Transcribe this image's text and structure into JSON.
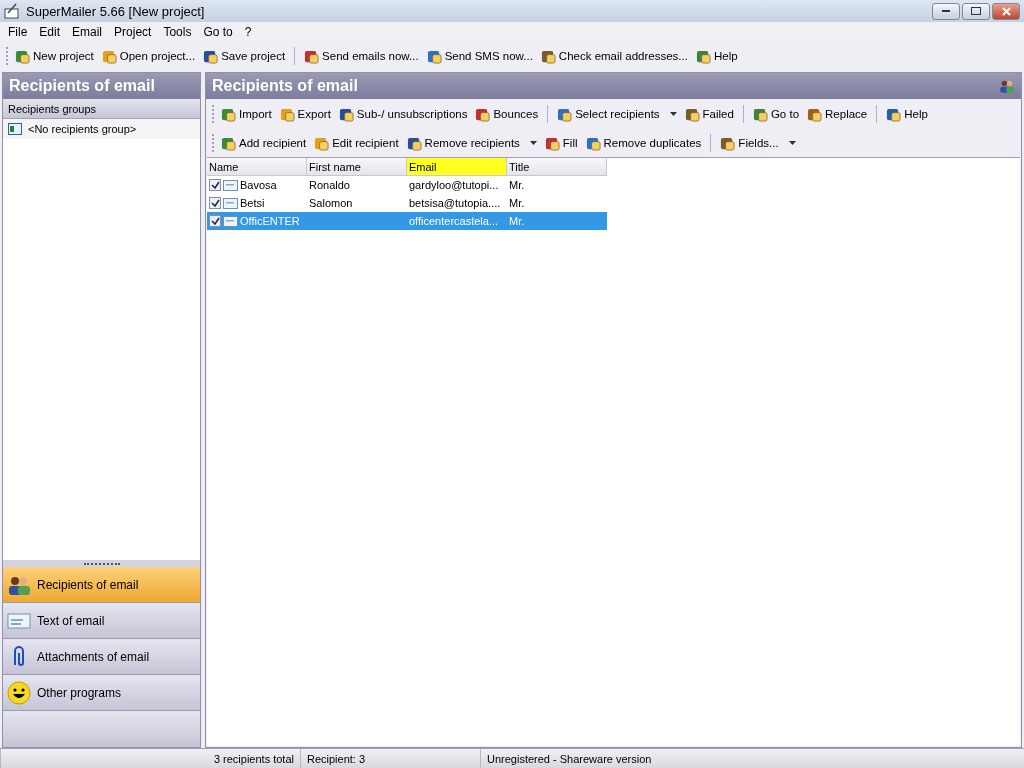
{
  "window": {
    "title": "SuperMailer 5.66 [New project]"
  },
  "menu": [
    "File",
    "Edit",
    "Email",
    "Project",
    "Tools",
    "Go to",
    "?"
  ],
  "toolbar": [
    {
      "label": "New project"
    },
    {
      "label": "Open project..."
    },
    {
      "label": "Save project"
    },
    {
      "label": "Send emails now...",
      "separator_before": true
    },
    {
      "label": "Send SMS now..."
    },
    {
      "label": "Check email addresses..."
    },
    {
      "label": "Help"
    }
  ],
  "left_panel": {
    "title": "Recipients of email",
    "groups_header": "Recipients groups",
    "groups": [
      {
        "label": "<No recipients group>"
      }
    ],
    "nav": [
      {
        "label": "Recipients of email",
        "selected": true
      },
      {
        "label": "Text of email",
        "selected": false
      },
      {
        "label": "Attachments of email",
        "selected": false
      },
      {
        "label": "Other programs",
        "selected": false
      }
    ]
  },
  "main": {
    "title": "Recipients of email",
    "toolbar_1": [
      {
        "label": "Import"
      },
      {
        "label": "Export"
      },
      {
        "label": "Sub-/ unsubscriptions"
      },
      {
        "label": "Bounces"
      },
      {
        "label": "Select recipients",
        "dropdown": true,
        "separator_before": true
      },
      {
        "label": "Failed"
      },
      {
        "label": "Go to",
        "separator_before": true
      },
      {
        "label": "Replace"
      },
      {
        "label": "Help",
        "separator_before": true
      }
    ],
    "toolbar_2": [
      {
        "label": "Add recipient"
      },
      {
        "label": "Edit recipient"
      },
      {
        "label": "Remove recipients",
        "dropdown": true
      },
      {
        "label": "Fill"
      },
      {
        "label": "Remove duplicates"
      },
      {
        "label": "Fields...",
        "dropdown": true,
        "separator_before": true
      }
    ],
    "table": {
      "columns": [
        {
          "label": "Name",
          "highlighted": false
        },
        {
          "label": "First name",
          "highlighted": false
        },
        {
          "label": "Email",
          "highlighted": true
        },
        {
          "label": "Title",
          "highlighted": false
        }
      ],
      "rows": [
        {
          "checked": true,
          "selected": false,
          "cells": [
            "Bavosa",
            "Ronaldo",
            "gardyloo@tutopi...",
            "Mr."
          ]
        },
        {
          "checked": true,
          "selected": false,
          "cells": [
            "Betsi",
            "Salomon",
            "betsisa@tutopia....",
            "Mr."
          ]
        },
        {
          "checked": true,
          "selected": true,
          "cells": [
            "OfficENTER",
            "",
            "officentercastela...",
            "Mr."
          ]
        }
      ]
    }
  },
  "status_bar": [
    "3 recipients total",
    "Recipient: 3",
    "Unregistered - Shareware version"
  ]
}
